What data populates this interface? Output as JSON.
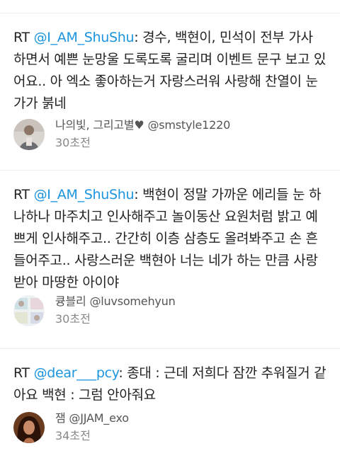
{
  "tweets": [
    {
      "rt": "RT ",
      "mention": "@I_AM_ShuShu",
      "text": ": 경수, 백현이, 민석이 전부 가사 하면서 예쁜 눈망울 도록도록 굴리며 이벤트 문구 보고 있어요.. 아 엑소 좋아하는거 자랑스러워 사랑해 찬열이 눈가가 붉네",
      "author": "나의빛, 그리고별♥ @smstyle1220",
      "time": "30초전",
      "avatar": "avatar-person-gray"
    },
    {
      "rt": "RT ",
      "mention": "@I_AM_ShuShu",
      "text": ": 백현이 정말 가까운 에리들 눈 하나하나 마주치고 인사해주고 놀이동산 요원처럼 밝고 예쁘게 인사해주고.. 간간히 이층 삼층도 올려봐주고 손 흔들어주고.. 사랑스러운 백현아 너는 네가 하는 만큼 사랑받아 마땅한 아이야",
      "author": "큥블리 @luvsomehyun",
      "time": "30초전",
      "avatar": "avatar-pastel-collage"
    },
    {
      "rt": "RT ",
      "mention": "@dear___pcy",
      "text": ": 종대 : 근데 저희다 잠깐 추워질거 같아요 백현 : 그럼 안아줘요",
      "author": "잼 @JJAM_exo",
      "time": "34초전",
      "avatar": "avatar-woman-dark-hair"
    }
  ]
}
